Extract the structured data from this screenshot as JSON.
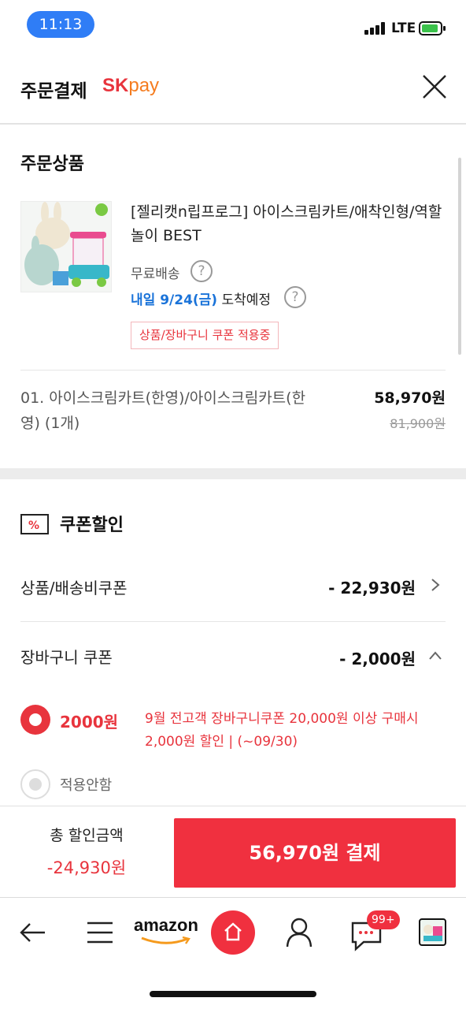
{
  "status_bar": {
    "time": "11:13",
    "network": "LTE"
  },
  "header": {
    "title": "주문결제",
    "brand_sk": "SK",
    "brand_pay": "pay"
  },
  "product_section": {
    "title": "주문상품",
    "name": "[젤리캣n립프로그] 아이스크림카트/애착인형/역할놀이 BEST",
    "shipping": "무료배송",
    "arrival_date": "내일 9/24(금)",
    "arrival_suffix": "도착예정",
    "coupon_tag": "상품/장바구니 쿠폰 적용중",
    "option": "01. 아이스크림카트(한영)/아이스크림카트(한영) (1개)",
    "price": "58,970원",
    "original_price": "81,900원"
  },
  "coupon_section": {
    "title": "쿠폰할인",
    "product_coupon_label": "상품/배송비쿠폰",
    "product_coupon_amount": "- 22,930원",
    "cart_coupon_label": "장바구니 쿠폰",
    "cart_coupon_amount": "- 2,000원",
    "option_amount": "2000원",
    "option_desc": "9월 전고객 장바구니쿠폰 20,000원 이상 구매시 2,000원 할인 | (~09/30)",
    "option_none": "적용안함"
  },
  "pay_bar": {
    "total_label": "총 할인금액",
    "total_value": "-24,930원",
    "pay_button": "56,970원 결제"
  },
  "toolbar": {
    "amazon": "amazon",
    "chat_badge": "99+"
  },
  "colors": {
    "accent": "#f0303f",
    "blue": "#1a73d9",
    "status_pill": "#2f7df6"
  }
}
